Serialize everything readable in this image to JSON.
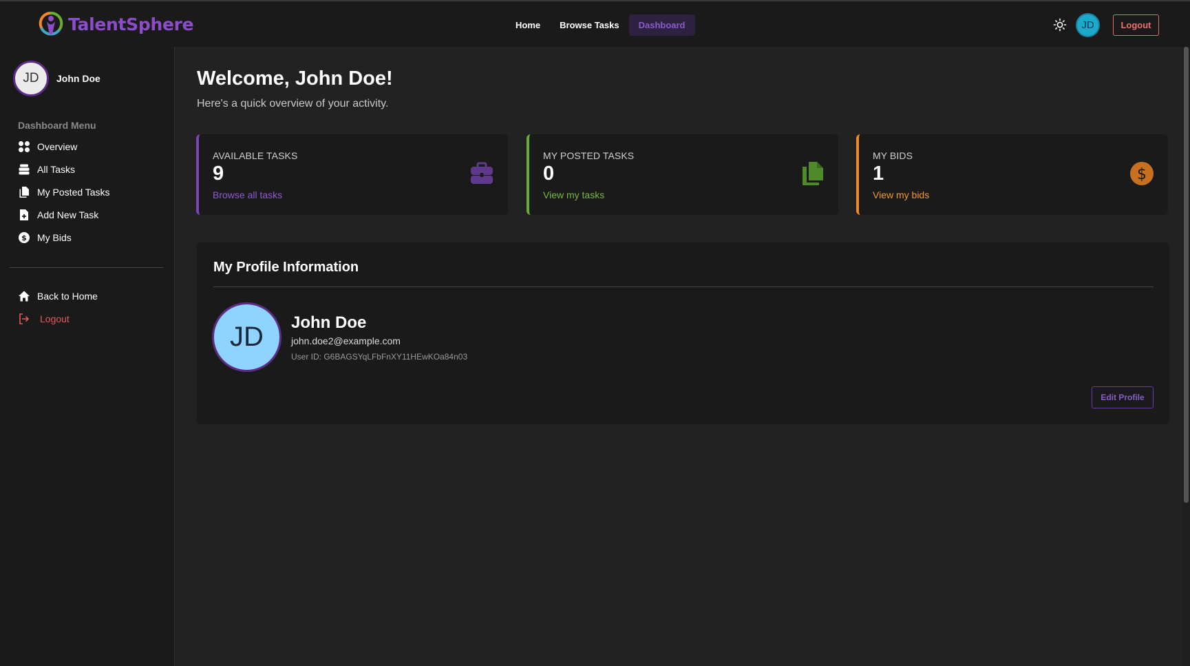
{
  "navbar": {
    "brand": "TalentSphere",
    "links": [
      {
        "label": "Home"
      },
      {
        "label": "Browse Tasks"
      },
      {
        "label": "Dashboard",
        "active": true
      }
    ],
    "avatar_initials": "JD",
    "logout_label": "Logout",
    "theme_icon": "sun-icon"
  },
  "sidebar": {
    "avatar_initials": "JD",
    "username": "John Doe",
    "menu_heading": "Dashboard Menu",
    "items": [
      {
        "label": "Overview",
        "icon": "grid-icon"
      },
      {
        "label": "All Tasks",
        "icon": "layers-icon"
      },
      {
        "label": "My Posted Tasks",
        "icon": "copy-icon"
      },
      {
        "label": "Add New Task",
        "icon": "file-plus-icon"
      },
      {
        "label": "My Bids",
        "icon": "dollar-circle-icon"
      }
    ],
    "bottom": {
      "home_label": "Back to Home",
      "logout_label": "Logout"
    }
  },
  "main": {
    "welcome_title": "Welcome, John Doe!",
    "welcome_subtitle": "Here's a quick overview of your activity.",
    "stats": [
      {
        "label": "AVAILABLE TASKS",
        "value": "9",
        "link": "Browse all tasks",
        "icon": "briefcase-icon",
        "color": "#7b46b8"
      },
      {
        "label": "MY POSTED TASKS",
        "value": "0",
        "link": "View my tasks",
        "icon": "copy-icon",
        "color": "#6aac34"
      },
      {
        "label": "MY BIDS",
        "value": "1",
        "link": "View my bids",
        "icon": "dollar-circle-icon",
        "color": "#f08a24"
      }
    ],
    "profile": {
      "title": "My Profile Information",
      "avatar_initials": "JD",
      "name": "John Doe",
      "email": "john.doe2@example.com",
      "user_id": "User ID: G6BAGSYqLFbFnXY11HEwKOa84n03",
      "edit_label": "Edit Profile"
    }
  },
  "colors": {
    "accent": "#8b4dc8",
    "danger": "#ee6f6f",
    "background": "#222222",
    "surface": "#1a1a1a"
  }
}
